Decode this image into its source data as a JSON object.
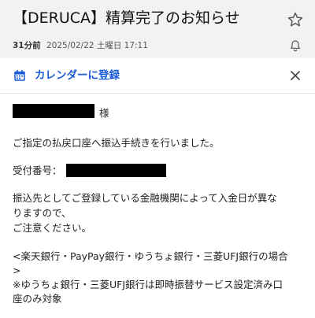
{
  "email": {
    "subject": "【DERUCA】精算完了のお知らせ",
    "time_ago": "31分前",
    "datetime": "2025/02/22 土曜日 17:11"
  },
  "calendar_bar": {
    "label": "カレンダーに登録",
    "icon": "calendar-icon",
    "accent_color": "#1a5bd6"
  },
  "icons": {
    "star": "star-icon",
    "bell": "bell-icon",
    "close": "close-icon"
  },
  "message": {
    "honorific": "様",
    "line1": "ご指定の払戻口座へ振込手続きを行いました。",
    "receipt_label": "受付番号：",
    "para2_line1": "振込先としてご登録している金融機関によって入金日が異な",
    "para2_line2": "りますので、",
    "para2_line3": "ご注意ください。",
    "para3_line1": "<楽天銀行・PayPay銀行・ゆうちょ銀行・三菱UFJ銀行の場合",
    "para3_line2": ">",
    "para3_line3": "※ゆうちょ銀行・三菱UFJ銀行は即時振替サービス設定済み口",
    "para3_line4": "座のみ対象"
  }
}
